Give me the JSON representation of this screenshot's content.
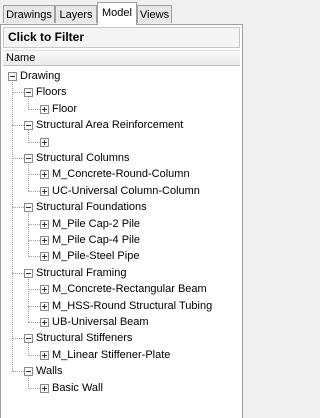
{
  "tabs": [
    "Drawings",
    "Layers",
    "Model",
    "Views"
  ],
  "active_tab": "Model",
  "filter_label": "Click to Filter",
  "column_header": "Name",
  "tree": {
    "root": "Drawing",
    "items": [
      {
        "label": "Floors",
        "children": [
          "Floor"
        ]
      },
      {
        "label": "Structural Area Reinforcement",
        "children": [
          ""
        ]
      },
      {
        "label": "Structural Columns",
        "children": [
          "M_Concrete-Round-Column",
          "UC-Universal Column-Column"
        ]
      },
      {
        "label": "Structural Foundations",
        "children": [
          "M_Pile Cap-2 Pile",
          "M_Pile Cap-4 Pile",
          "M_Pile-Steel Pipe"
        ]
      },
      {
        "label": "Structural Framing",
        "children": [
          "M_Concrete-Rectangular Beam",
          "M_HSS-Round Structural Tubing",
          "UB-Universal Beam"
        ]
      },
      {
        "label": "Structural Stiffeners",
        "children": [
          "M_Linear Stiffener-Plate"
        ]
      },
      {
        "label": "Walls",
        "children": [
          "Basic Wall"
        ]
      }
    ]
  }
}
